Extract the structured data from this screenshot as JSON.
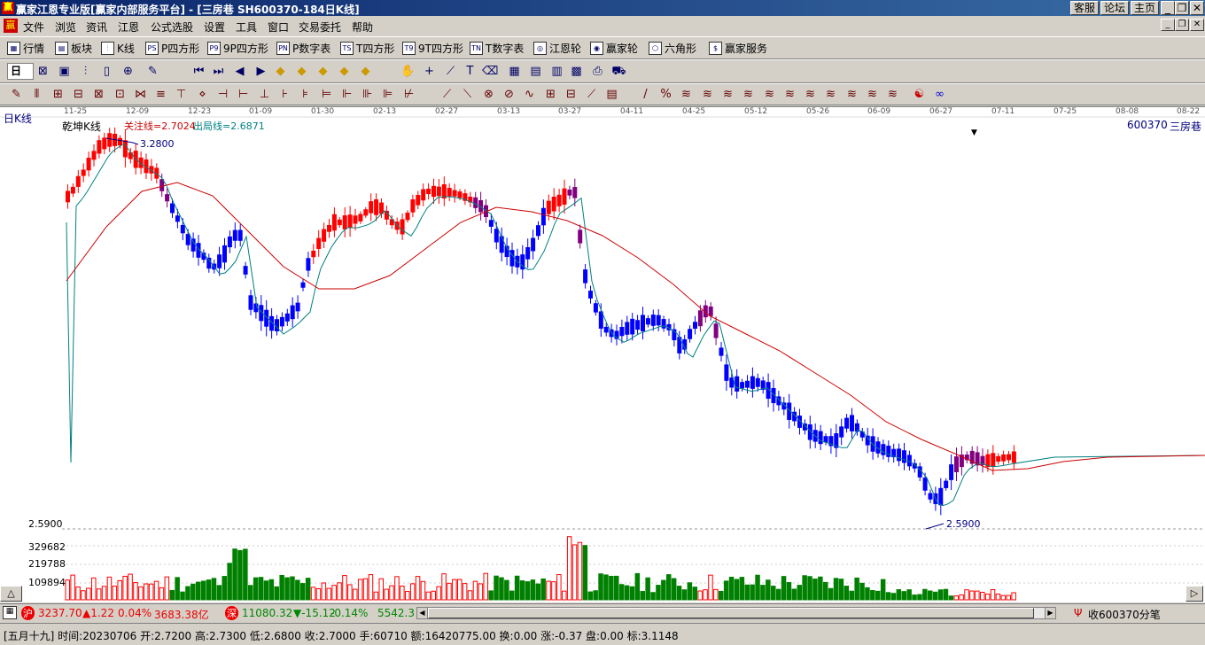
{
  "window": {
    "title": "赢家江恩专业版[赢家内部服务平台] - [三房巷  SH600370-184日K线]",
    "app_icon": "赢",
    "btn_service": "客服",
    "btn_forum": "论坛",
    "btn_home": "主页"
  },
  "menu": {
    "items": [
      "文件",
      "浏览",
      "资讯",
      "江恩",
      "公式选股",
      "设置",
      "工具",
      "窗口",
      "交易委托",
      "帮助"
    ]
  },
  "toolbar1": {
    "items": [
      {
        "icon": "market-icon",
        "glyph": "▦",
        "label": "行情"
      },
      {
        "icon": "sector-icon",
        "glyph": "▤",
        "label": "板块"
      },
      {
        "icon": "kline-icon",
        "glyph": "⫶",
        "label": "K线"
      },
      {
        "icon": "p-square-icon",
        "glyph": "PS",
        "label": "P四方形"
      },
      {
        "icon": "9p-square-icon",
        "glyph": "P9",
        "label": "9P四方形"
      },
      {
        "icon": "p-number-table-icon",
        "glyph": "PN",
        "label": "P数字表"
      },
      {
        "icon": "t-square-icon",
        "glyph": "TS",
        "label": "T四方形"
      },
      {
        "icon": "9t-square-icon",
        "glyph": "T9",
        "label": "9T四方形"
      },
      {
        "icon": "t-number-table-icon",
        "glyph": "TN",
        "label": "T数字表"
      },
      {
        "icon": "gann-wheel-icon",
        "glyph": "◎",
        "label": "江恩轮"
      },
      {
        "icon": "winner-wheel-icon",
        "glyph": "◉",
        "label": "赢家轮"
      },
      {
        "icon": "hexagon-icon",
        "glyph": "⬡",
        "label": "六角形"
      },
      {
        "icon": "dollar-icon",
        "glyph": "$",
        "label": "赢家服务"
      }
    ]
  },
  "toolbar2": {
    "period": "日",
    "icons": [
      "zoom-icon",
      "plate-icon",
      "kline-style-icon",
      "tick-icon",
      "crosshair-icon",
      "sketch-icon",
      "first-icon",
      "last-icon",
      "prev-icon",
      "next-icon",
      "diamond1-icon",
      "diamond2-icon",
      "diamond3-icon",
      "diamond4-icon",
      "diamond5-icon",
      "hand-icon",
      "cross-icon",
      "draw-icon",
      "text-icon",
      "eraser-icon",
      "calendar-icon",
      "calc-icon",
      "grid-icon",
      "save-icon",
      "print-icon",
      "truck-icon"
    ]
  },
  "toolbar3": {
    "icons": [
      "pencil-icon",
      "bars-icon",
      "tools1-icon",
      "tools2-icon",
      "tools3-icon",
      "tools4-icon",
      "tools5-icon",
      "circle-icon",
      "tools6-icon",
      "tools7-icon",
      "tools8-icon",
      "tools9-icon",
      "tools10-icon",
      "tools11-icon",
      "tools12-icon",
      "tools13-icon",
      "tools14-icon",
      "tools15-icon",
      "tools16-icon",
      "tools17-icon",
      "fan-icon",
      "square-fan-icon",
      "box-icon",
      "line-icon",
      "wave-icon",
      "grid2-icon",
      "grid3-icon",
      "diag-icon",
      "table-icon",
      "slash-icon",
      "percent-icon",
      "fib-icon",
      "fib2-icon",
      "fib3-icon",
      "fib4-icon",
      "fib5-icon",
      "fib6-icon",
      "fib7-icon",
      "fib8-icon",
      "fib9-icon",
      "fib10-icon",
      "fib11-icon",
      "yinyang-icon",
      "infinity-icon"
    ]
  },
  "chart": {
    "period_label": "日K线",
    "indicator_name": "乾坤K线",
    "attention_line": "关注线=2.7024",
    "exit_line": "出局线=2.6871",
    "stock_code": "600370",
    "stock_name": "三房巷",
    "high_label": "3.2800",
    "low_label": "2.5900",
    "axis_low": "2.5900",
    "vol_labels": [
      "329682",
      "219788",
      "109894"
    ],
    "dates": [
      "11-25",
      "12-09",
      "12-23",
      "01-09",
      "01-30",
      "02-13",
      "02-27",
      "03-13",
      "03-27",
      "04-11",
      "04-25",
      "05-12",
      "05-26",
      "06-09",
      "06-27",
      "07-11",
      "07-25",
      "08-08",
      "08-22"
    ],
    "colors": {
      "red": "#ff0000",
      "blue": "#0000ff",
      "purple": "#800080",
      "green": "#008000",
      "red_line": "#cc0000",
      "teal_line": "#008080"
    }
  },
  "chart_data": {
    "type": "candlestick",
    "title": "乾坤K线",
    "series_names": [
      "关注线",
      "出局线"
    ],
    "y_range": [
      2.59,
      3.28
    ],
    "x_labels": [
      "11-25",
      "12-09",
      "12-23",
      "01-09",
      "01-30",
      "02-13",
      "02-27",
      "03-13",
      "03-27",
      "04-11",
      "04-25",
      "05-12",
      "05-26",
      "06-09",
      "06-27",
      "07-11",
      "07-25",
      "08-08",
      "08-22"
    ],
    "last_bar": {
      "date": "20230706",
      "open": 2.72,
      "high": 2.73,
      "low": 2.68,
      "close": 2.7
    }
  },
  "status1": {
    "sh_badge": "沪",
    "sh_index": "3237.70",
    "sh_change": "▲1.22",
    "sh_pct": "0.04%",
    "sh_amount": "3683.38亿",
    "sz_badge": "深",
    "sz_index": "11080.32",
    "sz_change": "▼-15.12",
    "sz_pct": "-0.14%",
    "sz_amount": "5542.3",
    "receive": "收600370分笔"
  },
  "status2": {
    "text": "[五月十九] 时间:20230706 开:2.7200 高:2.7300 低:2.6800 收:2.7000 手:60710 额:16420775.00 换:0.00 涨:-0.37 盘:0.00 标:3.1148"
  }
}
